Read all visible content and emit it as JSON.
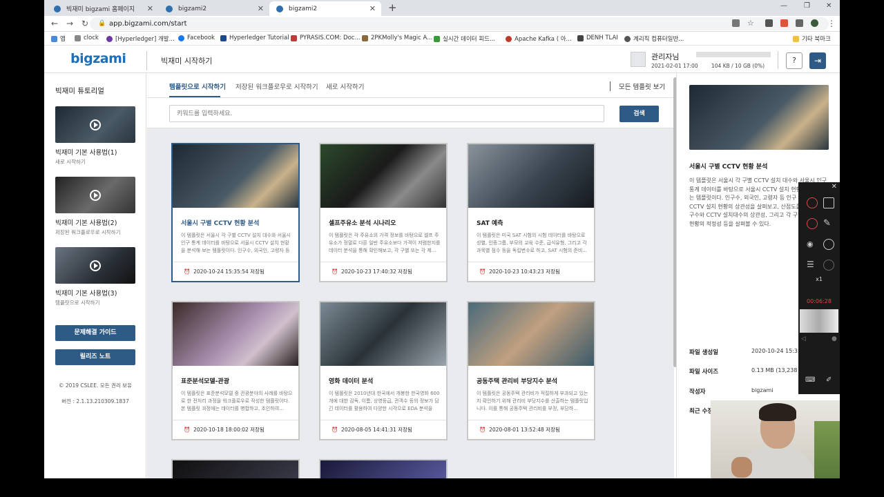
{
  "browser": {
    "tabs": [
      {
        "label": "빅재미 bigzami 홈페이지"
      },
      {
        "label": "bigzami2"
      },
      {
        "label": "bigzami2"
      }
    ],
    "url": "app.bigzami.com/start",
    "bookmarks": [
      {
        "label": "앱"
      },
      {
        "label": "clock"
      },
      {
        "label": "[Hyperledger] 개발..."
      },
      {
        "label": "Facebook"
      },
      {
        "label": "Hyperledger Tutorial"
      },
      {
        "label": "PYRASIS.COM: Doc..."
      },
      {
        "label": "2PKMolly's Magic A..."
      },
      {
        "label": "실시간 데이터 피드..."
      },
      {
        "label": "Apache Kafka ( 아..."
      },
      {
        "label": "DENH TLAI"
      },
      {
        "label": "계리직 컴퓨터일반..."
      },
      {
        "label": "기타 북마크"
      }
    ]
  },
  "header": {
    "logo": "bigzami",
    "page_title": "빅재미 시작하기",
    "user_name": "관리자님",
    "user_date": "2021-02-01 17:00",
    "storage_text": "104 KB / 10 GB (0%)",
    "storage_fraction": 0.0,
    "help_icon": "help-circle-icon",
    "logout_icon": "logout-icon"
  },
  "sidebar": {
    "title": "빅재미 튜토리얼",
    "tutorials": [
      {
        "title": "빅재미 기본 사용법(1)",
        "subtitle": "새로 시작하기"
      },
      {
        "title": "빅재미 기본 사용법(2)",
        "subtitle": "저장된 워크플로우로 시작하기"
      },
      {
        "title": "빅재미 기본 사용법(3)",
        "subtitle": "템플릿으로 시작하기"
      }
    ],
    "buttons": {
      "guide": "문제해결 가이드",
      "release": "릴리즈 노트"
    },
    "copyright": "© 2019 CSLEE. 모든 권리 보유",
    "version": "버전 : 2.1.13.210309.1837"
  },
  "main": {
    "tabs": [
      {
        "label": "템플릿으로 시작하기",
        "active": true
      },
      {
        "label": "저장된 워크플로우로 시작하기",
        "active": false
      },
      {
        "label": "새로 시작하기",
        "active": false
      }
    ],
    "all_templates": "모든 템플릿 보기",
    "search": {
      "placeholder": "키워드를 입력하세요.",
      "button": "검색"
    },
    "cards": [
      {
        "title": "서울시 구별 CCTV 현황 분석",
        "desc": "이 템플릿은 서울시 각 구별 CCTV 설치 대수와 서울시 인구 통계 데이터를 바탕으로 서울시 CCTV 설치 현황을 분석해 보는 템플릿이다. 인구수, 외국인, 고령자 등 인...",
        "saved": "2020-10-24 15:35:54 저장됨",
        "selected": true
      },
      {
        "title": "셀프주유소 분석 시나리오",
        "desc": "이 템플릿은 각 주유소의 가격 정보를 바탕으로 셀프 주유소가 정말로 다른 일반 주유소보다 가격이 저렴한지를 데이터 분석을 통해 확인해보고, 각 구별 또는 각 제...",
        "saved": "2020-10-23 17:40:32 저장됨",
        "selected": false
      },
      {
        "title": "SAT 예측",
        "desc": "이 템플릿은 미국 SAT 시험의 시험 데이터를 바탕으로 성별, 인종그룹, 부모의 교육 수준, 급식유형, 그리고 각 과목별 점수 등을 독립변수로 하고, SAT 시험의 준비...",
        "saved": "2020-10-23 10:43:23 저장됨",
        "selected": false
      },
      {
        "title": "표준분석모델-관광",
        "desc": "이 템플릿은 표준분석모델 중 관광분야의 사례를 바탕으로 한 전처리 과정을 워크플로우로 작성한 템플릿이다. 본 템플릿 과정에는 데이터를 병합하고, 조인하여...",
        "saved": "2020-10-18 18:00:02 저장됨",
        "selected": false
      },
      {
        "title": "영화 데이터 분석",
        "desc": "이 템플릿은 2010년대 한국에서 개봉한 한국영화 600개에 대한 감독, 이름, 상영등급, 관객수 등의 정보가 담긴 데이터를 활용하여 다양한 시각으로 EDA 분석을 해...",
        "saved": "2020-08-05 14:41:31 저장됨",
        "selected": false
      },
      {
        "title": "공동주택 관리비 부당지수 분석",
        "desc": "이 템플릿은 공동주택 관리비가 적절하게 부과되고 있는지 확인하기 위해 관리비 부당지수를 산출하는 템플릿입니다. 이를 통해 공동주택 관리비를 부정, 부당하...",
        "saved": "2020-08-01 13:52:48 저장됨",
        "selected": false
      }
    ]
  },
  "detail": {
    "title": "서울시 구별 CCTV 현황 분석",
    "desc": "이 템플릿은 서울시 각 구별 CCTV 설치 대수와 서울시 인구 통계 데이터를 바탕으로 서울시 CCTV 설치 현황을 분석해 보는 템플릿이다. 인구수, 외국인, 고령자 등 인구 특성에 따른 CCTV 설치 현황의 상관성을 살펴보고, 산점도를 바탕으로 인구수와 CCTV 설치대수의 상관성, 그리고 각 구별 CCTV 설치 현황의 적정성 등을 살펴볼 수 있다.",
    "meta": [
      {
        "label": "파일 생성일",
        "value": "2020-10-24 15:35:5"
      },
      {
        "label": "파일 사이즈",
        "value": "0.13 MB (13,238 by"
      },
      {
        "label": "작성자",
        "value": "bigzami"
      },
      {
        "label": "최근 수정",
        "value": ""
      }
    ]
  },
  "recorder": {
    "zoom": "x1",
    "time": "00:06:28"
  }
}
